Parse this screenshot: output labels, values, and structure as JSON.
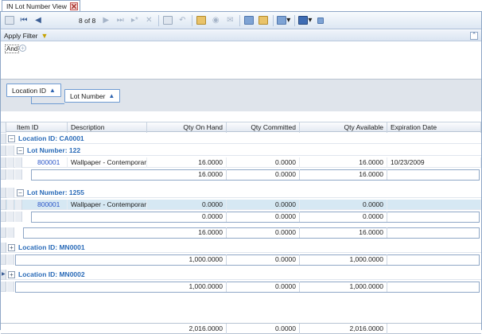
{
  "tab": {
    "title": "IN Lot Number View",
    "close_icon": "close-icon"
  },
  "toolbar": {
    "pager_text": "8 of 8",
    "icons": [
      "save-icon",
      "first-record-icon",
      "previous-record-icon",
      "next-record-icon",
      "last-record-icon",
      "insert-icon",
      "delete-icon",
      "copy-icon",
      "undo-icon",
      "find-icon",
      "record-icon",
      "mail-icon",
      "copy-clipboard-icon",
      "paste-icon",
      "export-icon",
      "layout-icon",
      "options-icon"
    ]
  },
  "filter": {
    "title": "Apply Filter",
    "and_label": "And"
  },
  "groupby": {
    "chips": [
      "Location ID",
      "Lot Number"
    ]
  },
  "columns": [
    "Item ID",
    "Description",
    "Qty On Hand",
    "Qty Committed",
    "Qty  Available",
    "Expiration Date"
  ],
  "groups": [
    {
      "title": "Location ID: CA0001",
      "lots": [
        {
          "title": "Lot Number: 122",
          "rows": [
            {
              "item_id": "800001",
              "description": "Wallpaper - Contemporary",
              "on_hand": "16.0000",
              "committed": "0.0000",
              "available": "16.0000",
              "expiration": "10/23/2009"
            }
          ],
          "summary": {
            "on_hand": "16.0000",
            "committed": "0.0000",
            "available": "16.0000"
          }
        },
        {
          "title": "Lot Number: 1255",
          "rows": [
            {
              "item_id": "800001",
              "description": "Wallpaper - Contemporary",
              "on_hand": "0.0000",
              "committed": "0.0000",
              "available": "0.0000",
              "expiration": ""
            }
          ],
          "summary": {
            "on_hand": "0.0000",
            "committed": "0.0000",
            "available": "0.0000"
          }
        }
      ],
      "summary": {
        "on_hand": "16.0000",
        "committed": "0.0000",
        "available": "16.0000"
      }
    },
    {
      "title": "Location ID: MN0001",
      "summary": {
        "on_hand": "1,000.0000",
        "committed": "0.0000",
        "available": "1,000.0000"
      }
    },
    {
      "title": "Location ID: MN0002",
      "summary": {
        "on_hand": "1,000.0000",
        "committed": "0.0000",
        "available": "1,000.0000"
      }
    }
  ],
  "totals": {
    "on_hand": "2,016.0000",
    "committed": "0.0000",
    "available": "2,016.0000"
  },
  "colors": {
    "link": "#2a55c8",
    "group_title": "#2a6bb8",
    "selected_row": "#d6e8f3",
    "border": "#8fa7c6"
  }
}
